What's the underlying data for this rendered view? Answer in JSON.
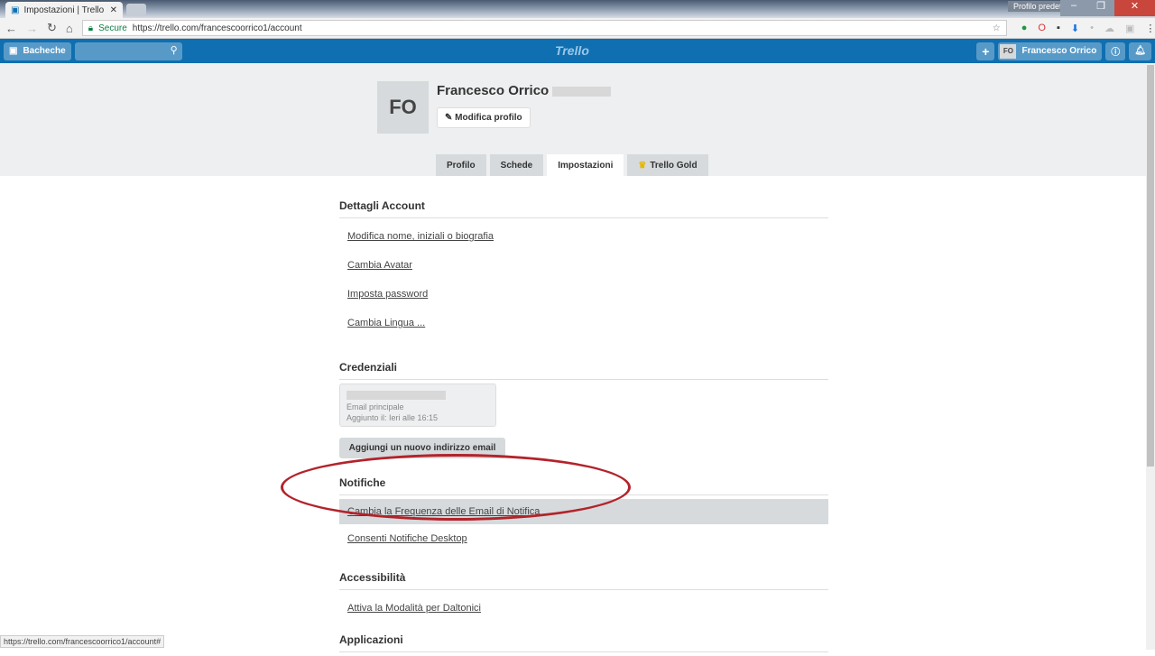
{
  "browser": {
    "tab_title": "Impostazioni | Trello",
    "profile": "Profilo predef...",
    "secure": "Secure",
    "url": "https://trello.com/francescoorrico1/account",
    "status_url": "https://trello.com/francescoorrico1/account#"
  },
  "topbar": {
    "boards": "Bacheche",
    "logo": "Trello",
    "user_initials": "FO",
    "user_name": "Francesco Orrico"
  },
  "profile": {
    "initials": "FO",
    "name": "Francesco Orrico",
    "edit": "Modifica profilo",
    "tabs": [
      "Profilo",
      "Schede",
      "Impostazioni",
      "Trello Gold"
    ],
    "active_tab": "Impostazioni"
  },
  "sections": {
    "account": {
      "title": "Dettagli Account",
      "links": [
        "Modifica nome, iniziali o biografia",
        "Cambia Avatar",
        "Imposta password",
        "Cambia Lingua ..."
      ]
    },
    "credentials": {
      "title": "Credenziali",
      "email_label": "Email principale",
      "added": "Aggiunto il: Ieri alle 16:15",
      "add_button": "Aggiungi un nuovo indirizzo email"
    },
    "notifications": {
      "title": "Notifiche",
      "links": [
        "Cambia la Frequenza delle Email di Notifica",
        "Consenti Notifiche Desktop"
      ]
    },
    "accessibility": {
      "title": "Accessibilità",
      "links": [
        "Attiva la Modalità per Daltonici"
      ]
    },
    "apps": {
      "title": "Applicazioni"
    }
  },
  "annotation_color": "#b3232b"
}
